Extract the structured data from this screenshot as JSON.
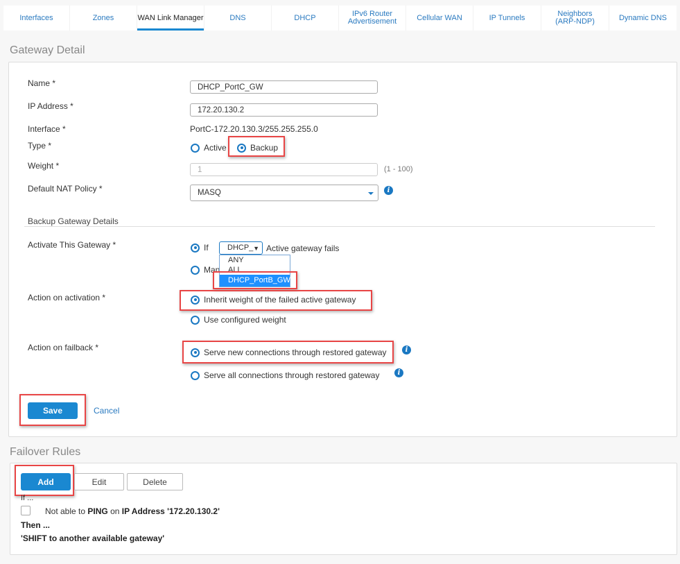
{
  "tabs": [
    {
      "label": "Interfaces",
      "active": false
    },
    {
      "label": "Zones",
      "active": false
    },
    {
      "label": "WAN Link Manager",
      "active": true
    },
    {
      "label": "DNS",
      "active": false
    },
    {
      "label": "DHCP",
      "active": false
    },
    {
      "label": "IPv6 Router Advertisement",
      "active": false
    },
    {
      "label": "Cellular WAN",
      "active": false
    },
    {
      "label": "IP Tunnels",
      "active": false
    },
    {
      "label": "Neighbors (ARP-NDP)",
      "active": false
    },
    {
      "label": "Dynamic DNS",
      "active": false
    }
  ],
  "gateway_detail": {
    "title": "Gateway Detail",
    "name_label": "Name *",
    "name_value": "DHCP_PortC_GW",
    "ip_label": "IP Address *",
    "ip_value": "172.20.130.2",
    "interface_label": "Interface *",
    "interface_value": "PortC-172.20.130.3/255.255.255.0",
    "type_label": "Type *",
    "type_options": [
      "Active",
      "Backup"
    ],
    "type_selected": "Backup",
    "weight_label": "Weight *",
    "weight_value": "1",
    "weight_hint": "(1 - 100)",
    "nat_label": "Default NAT Policy *",
    "nat_value": "MASQ",
    "info_icon": "i"
  },
  "backup_details": {
    "heading": "Backup Gateway Details",
    "activate_label": "Activate This Gateway *",
    "activate_if_label": "If",
    "activate_select_value": "DHCP_",
    "activate_select_arrow": "▼",
    "activate_suffix": "Active gateway fails",
    "activate_manual_label": "Manually",
    "activate_manual_visible": "Man",
    "dropdown_options": [
      "ANY",
      "ALL",
      "DHCP_PortB_GW"
    ],
    "dropdown_selected": "DHCP_PortB_GW",
    "action_activation_label": "Action on activation *",
    "action_activation_options": [
      "Inherit weight of the failed active gateway",
      "Use configured weight"
    ],
    "action_activation_selected": "Inherit weight of the failed active gateway",
    "action_failback_label": "Action on failback *",
    "action_failback_options": [
      "Serve new connections through restored gateway",
      "Serve all connections through restored gateway"
    ],
    "action_failback_selected": "Serve new connections through restored gateway"
  },
  "actions": {
    "save_label": "Save",
    "cancel_label": "Cancel"
  },
  "failover": {
    "title": "Failover Rules",
    "add_label": "Add",
    "edit_label": "Edit",
    "delete_label": "Delete",
    "if_label": "If ...",
    "rule_prefix": "Not able to",
    "rule_protocol": "PING",
    "rule_on": "on",
    "rule_target": "IP Address '172.20.130.2'",
    "then_label": "Then ...",
    "then_action": "'SHIFT to another available gateway'"
  },
  "colors": {
    "accent": "#1a88d1",
    "highlight": "#e84545",
    "link": "#2a7ac0"
  }
}
